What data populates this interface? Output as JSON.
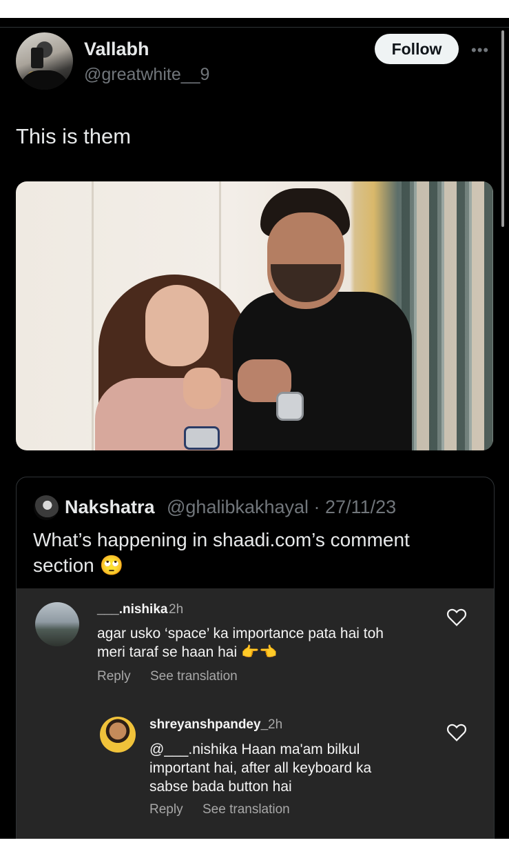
{
  "post": {
    "author_name": "Vallabh",
    "author_handle": "@greatwhite__9",
    "follow_label": "Follow",
    "more_label": "•••",
    "text": "This is them"
  },
  "quoted": {
    "name": "Nakshatra",
    "meta": "@ghalibkakhayal · 27/11/23",
    "text": "What’s happening in shaadi.com’s comment section 🙄"
  },
  "comments": [
    {
      "user": "___.nishika",
      "time": "2h",
      "text_line1": "agar usko ‘space’ ka importance pata hai toh",
      "text_line2": "meri taraf se haan hai 👉👈",
      "reply_label": "Reply",
      "translate_label": "See translation"
    },
    {
      "user": "shreyanshpandey_",
      "time": "2h",
      "text_line1": "@___.nishika Haan ma'am bilkul",
      "text_line2": "important hai, after all keyboard ka",
      "text_line3": "sabse bada button hai",
      "reply_label": "Reply",
      "translate_label": "See translation"
    }
  ],
  "colors": {
    "background": "#000000",
    "primary_text": "#e7e9ea",
    "secondary_text": "#71767b",
    "follow_bg": "#eff3f4",
    "comment_panel": "#262626"
  }
}
